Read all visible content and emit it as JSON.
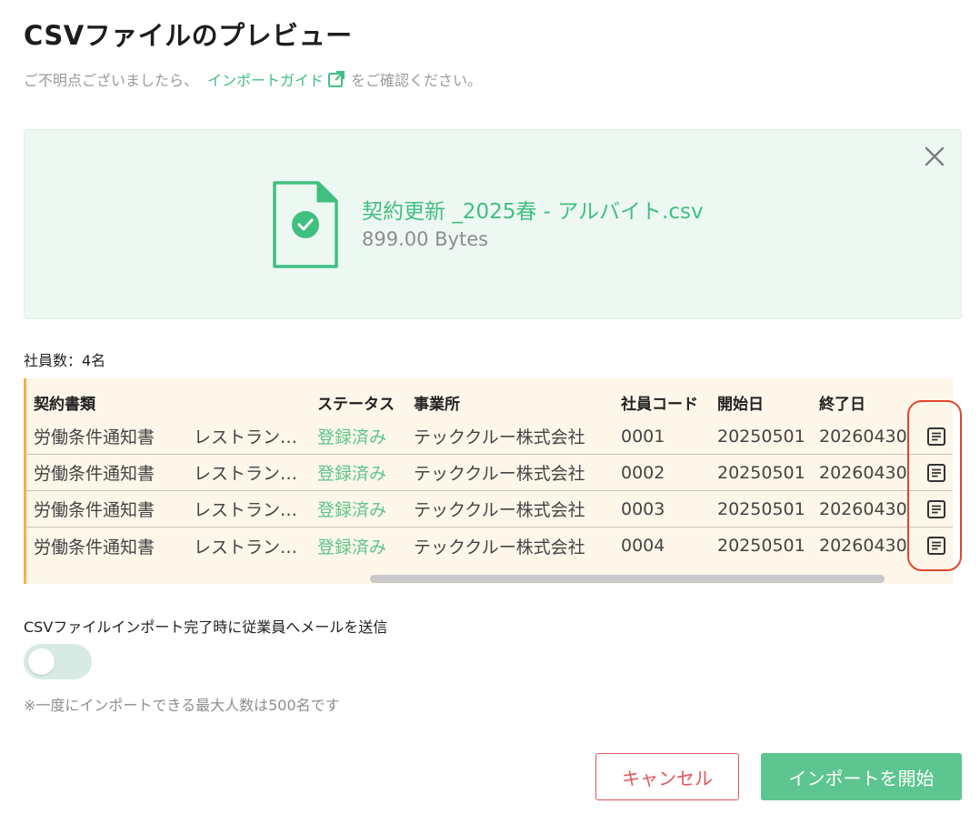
{
  "header": {
    "title": "CSVファイルのプレビュー",
    "help_prefix": "ご不明点ございましたら、",
    "help_link": "インポートガイド",
    "help_suffix": "をご確認ください。"
  },
  "file": {
    "name": "契約更新 _2025春 - アルバイト.csv",
    "size": "899.00 Bytes"
  },
  "employee_count": "社員数：4名",
  "table": {
    "headers": {
      "type": "契約書類",
      "template": "",
      "status": "ステータス",
      "office": "事業所",
      "code": "社員コード",
      "start": "開始日",
      "end": "終了日"
    },
    "rows": [
      {
        "type": "労働条件通知書",
        "template": "レストラン…",
        "status": "登録済み",
        "office": "テッククルー株式会社",
        "code": "0001",
        "start": "20250501",
        "end": "20260430"
      },
      {
        "type": "労働条件通知書",
        "template": "レストラン…",
        "status": "登録済み",
        "office": "テッククルー株式会社",
        "code": "0002",
        "start": "20250501",
        "end": "20260430"
      },
      {
        "type": "労働条件通知書",
        "template": "レストラン…",
        "status": "登録済み",
        "office": "テッククルー株式会社",
        "code": "0003",
        "start": "20250501",
        "end": "20260430"
      },
      {
        "type": "労働条件通知書",
        "template": "レストラン…",
        "status": "登録済み",
        "office": "テッククルー株式会社",
        "code": "0004",
        "start": "20250501",
        "end": "20260430"
      }
    ]
  },
  "notify": {
    "label": "CSVファイルインポート完了時に従業員へメールを送信",
    "enabled": false
  },
  "note": "※一度にインポートできる最大人数は500名です",
  "actions": {
    "cancel": "キャンセル",
    "start": "インポートを開始"
  },
  "colors": {
    "accent": "#5dc58f",
    "danger": "#e0545a",
    "highlight": "#e0472d",
    "table_bg": "#fdf6e9",
    "table_border": "#f4b24a"
  },
  "icons": {
    "external_link": "external-link-icon",
    "close": "close-icon",
    "file_check": "file-check-icon",
    "document": "document-icon"
  }
}
